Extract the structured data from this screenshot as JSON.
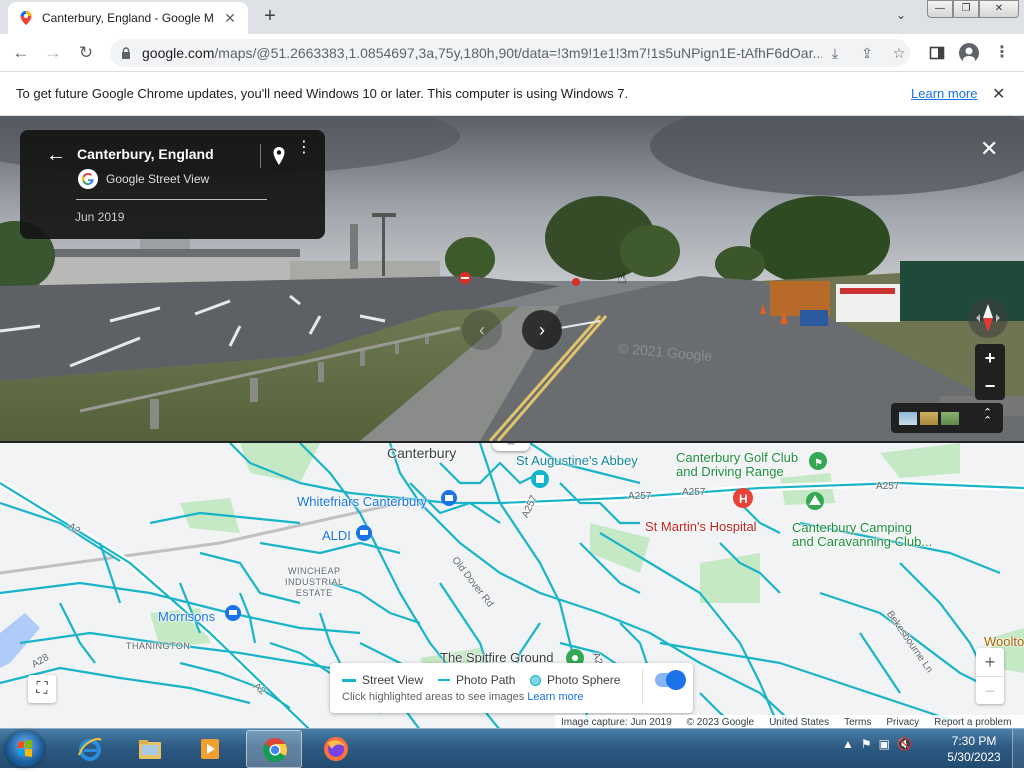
{
  "browser": {
    "tab_title": "Canterbury, England - Google Maps",
    "new_tab": "+",
    "url_host": "google.com",
    "url_path": "/maps/@51.2663383,1.0854697,3a,75y,180h,90t/data=!3m9!1e1!3m7!1s5uNPign1E-tAfhF6dOar...",
    "infobar_message": "To get future Google Chrome updates, you'll need Windows 10 or later. This computer is using Windows 7.",
    "infobar_link": "Learn more"
  },
  "streetview": {
    "place": "Canterbury, England",
    "source": "Google Street View",
    "date": "Jun 2019",
    "watermark": "© 2021 Google"
  },
  "map": {
    "labels": {
      "canterbury": "Canterbury",
      "st_augustines": "St Augustine's Abbey",
      "golf_club": "Canterbury Golf Club\nand Driving Range",
      "whitefriars": "Whitefriars Canterbury",
      "aldi": "ALDI",
      "st_martins": "St Martin's Hospital",
      "camping": "Canterbury Camping\nand Caravanning Club...",
      "wincheap": "WINCHEAP\nINDUSTRIAL\nESTATE",
      "morrisons": "Morrisons",
      "thanington": "THANINGTON",
      "spitfire": "The Spitfire Ground",
      "wootton": "Woolto",
      "old_dover_rd": "Old Dover Rd",
      "bekesbourne": "Bekesbourne Ln",
      "a257a": "A257",
      "a257b": "A257",
      "a257c": "A257",
      "a257d": "A257",
      "a2": "A2",
      "a28": "A28",
      "a2b": "A2",
      "a2c": "A2"
    },
    "legend": {
      "street_view": "Street View",
      "photo_path": "Photo Path",
      "photo_sphere": "Photo Sphere",
      "hint": "Click highlighted areas to see images",
      "hint_link": "Learn more"
    },
    "footer": [
      "Image capture: Jun 2019",
      "© 2023 Google",
      "United States",
      "Terms",
      "Privacy",
      "Report a problem"
    ],
    "zoom_in": "+",
    "zoom_out": "−",
    "coverage_color": "#1ab4c8"
  },
  "taskbar": {
    "time": "7:30 PM",
    "date": "5/30/2023"
  }
}
